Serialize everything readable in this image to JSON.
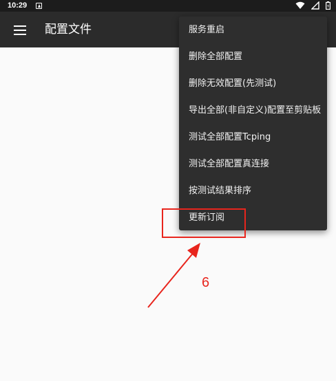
{
  "status_bar": {
    "time": "10:29",
    "icons": [
      "notification-icon",
      "wifi-icon",
      "signal-icon",
      "battery-icon"
    ]
  },
  "app_bar": {
    "menu_icon": "hamburger-menu-icon",
    "title": "配置文件"
  },
  "overflow_menu": {
    "items": [
      {
        "label": "服务重启"
      },
      {
        "label": "删除全部配置"
      },
      {
        "label": "删除无效配置(先测试)"
      },
      {
        "label": "导出全部(非自定义)配置至剪贴板"
      },
      {
        "label": "测试全部配置Tcping"
      },
      {
        "label": "测试全部配置真连接"
      },
      {
        "label": "按测试结果排序"
      },
      {
        "label": "更新订阅"
      }
    ]
  },
  "annotation": {
    "step_label": "6",
    "color": "#e8251d",
    "highlighted_item": "更新订阅"
  },
  "colors": {
    "status_bar": "#1c1c1c",
    "app_bar": "#2b2b2b",
    "menu_background": "#2e2e2e",
    "content_background": "#fafafa"
  }
}
